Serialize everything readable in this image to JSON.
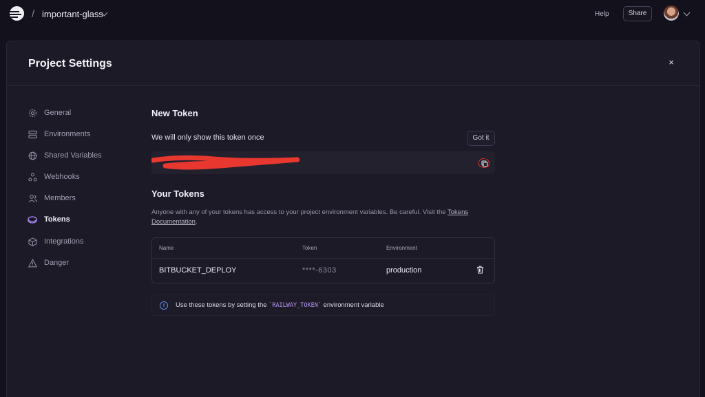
{
  "topbar": {
    "project_name": "important-glass",
    "help_label": "Help",
    "share_label": "Share"
  },
  "modal": {
    "title": "Project Settings",
    "close_glyph": "×"
  },
  "sidebar": {
    "items": [
      {
        "label": "General",
        "icon": "gear-icon"
      },
      {
        "label": "Environments",
        "icon": "layers-icon"
      },
      {
        "label": "Shared Variables",
        "icon": "globe-icon"
      },
      {
        "label": "Webhooks",
        "icon": "webhook-icon"
      },
      {
        "label": "Members",
        "icon": "users-icon"
      },
      {
        "label": "Tokens",
        "icon": "token-icon",
        "active": true
      },
      {
        "label": "Integrations",
        "icon": "cube-icon"
      },
      {
        "label": "Danger",
        "icon": "warning-icon"
      }
    ]
  },
  "new_token": {
    "heading": "New Token",
    "notice": "We will only show this token once",
    "got_it_label": "Got it"
  },
  "your_tokens": {
    "heading": "Your Tokens",
    "description_prefix": "Anyone with any of your tokens has access to your project environment variables. Be careful. Visit the ",
    "docs_link": "Tokens Documentation",
    "description_suffix": ".",
    "columns": {
      "name": "Name",
      "token": "Token",
      "environment": "Environment"
    },
    "rows": [
      {
        "name": "BITBUCKET_DEPLOY",
        "token": "****-6303",
        "environment": "production"
      }
    ]
  },
  "info": {
    "prefix": "Use these tokens by setting the ",
    "code": "`RAILWAY_TOKEN`",
    "suffix": " environment variable"
  },
  "colors": {
    "background": "#13111c",
    "modal": "#1c1a27",
    "accent": "#a78bfa",
    "info": "#5d8cf0",
    "redaction": "#e8372f"
  }
}
